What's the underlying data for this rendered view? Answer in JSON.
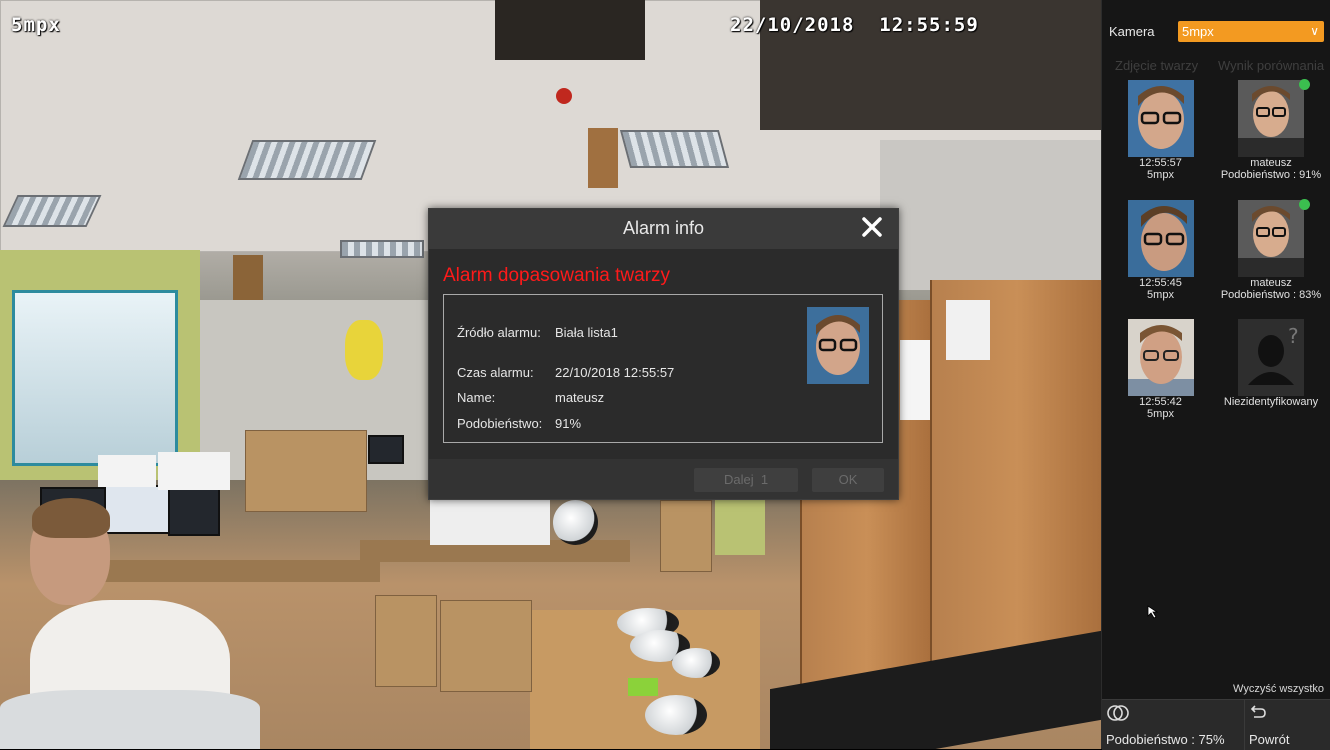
{
  "osd": {
    "camera_name": "5mpx",
    "datetime": "22/10/2018  12:55:59"
  },
  "dialog": {
    "title": "Alarm info",
    "heading": "Alarm dopasowania twarzy",
    "rows": [
      {
        "key": "Źródło alarmu:",
        "value": "Biała lista1"
      },
      {
        "key": "Czas alarmu:",
        "value": "22/10/2018 12:55:57"
      },
      {
        "key": "Name:",
        "value": "mateusz"
      },
      {
        "key": "Podobieństwo:",
        "value": "91%"
      }
    ],
    "next_label": "Dalej",
    "next_count": "1",
    "ok_label": "OK",
    "close_icon": "close-icon"
  },
  "panel": {
    "camera_label": "Kamera",
    "camera_value": "5mpx",
    "accent": "#f39a21",
    "col_capture": "Zdjęcie twarzy",
    "col_result": "Wynik porównania",
    "entries": [
      {
        "time": "12:55:57",
        "camera": "5mpx",
        "name": "mateusz",
        "similarity": "Podobieństwo : 91%"
      },
      {
        "time": "12:55:45",
        "camera": "5mpx",
        "name": "mateusz",
        "similarity": "Podobieństwo : 83%"
      },
      {
        "time": "12:55:42",
        "camera": "5mpx",
        "unknown": "Niezidentyfikowany"
      }
    ],
    "clear_all": "Wyczyść wszystko",
    "similarity_threshold": "Podobieństwo : 75%",
    "back": "Powrót"
  }
}
